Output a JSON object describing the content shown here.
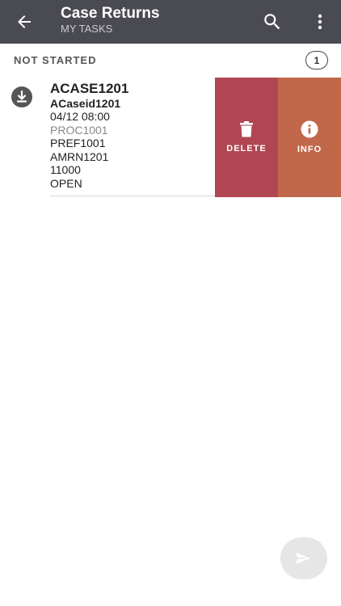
{
  "appbar": {
    "title": "Case Returns",
    "subtitle": "MY TASKS",
    "back_icon": "arrow-left-icon",
    "search_icon": "search-icon",
    "more_icon": "more-vertical-icon",
    "background": "#4a4a52"
  },
  "section": {
    "title": "NOT STARTED",
    "count": "1"
  },
  "task": {
    "case_no": "ACASE1201",
    "case_id": "ACaseid1201",
    "datetime": "04/12 08:00",
    "proc": "PROC1001",
    "pref": "PREF1001",
    "amrn": "AMRN1201",
    "amount": "11000",
    "status": "OPEN",
    "icon": "download-icon"
  },
  "actions": {
    "delete_label": "DELETE",
    "delete_color": "#b04652",
    "info_label": "INFO",
    "info_color": "#c1684a"
  },
  "fab": {
    "icon": "send-icon"
  }
}
